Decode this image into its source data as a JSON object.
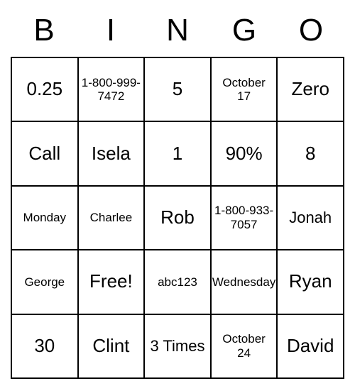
{
  "header": [
    "B",
    "I",
    "N",
    "G",
    "O"
  ],
  "grid": [
    [
      {
        "text": "0.25",
        "size": "normal"
      },
      {
        "text": "1-800-999-7472",
        "size": "small"
      },
      {
        "text": "5",
        "size": "normal"
      },
      {
        "text": "October 17",
        "size": "small"
      },
      {
        "text": "Zero",
        "size": "normal"
      }
    ],
    [
      {
        "text": "Call",
        "size": "normal"
      },
      {
        "text": "Isela",
        "size": "normal"
      },
      {
        "text": "1",
        "size": "normal"
      },
      {
        "text": "90%",
        "size": "normal"
      },
      {
        "text": "8",
        "size": "normal"
      }
    ],
    [
      {
        "text": "Monday",
        "size": "small"
      },
      {
        "text": "Charlee",
        "size": "small"
      },
      {
        "text": "Rob",
        "size": "normal"
      },
      {
        "text": "1-800-933-7057",
        "size": "small"
      },
      {
        "text": "Jonah",
        "size": "medium"
      }
    ],
    [
      {
        "text": "George",
        "size": "small"
      },
      {
        "text": "Free!",
        "size": "normal"
      },
      {
        "text": "abc123",
        "size": "small"
      },
      {
        "text": "Wednesday",
        "size": "small"
      },
      {
        "text": "Ryan",
        "size": "normal"
      }
    ],
    [
      {
        "text": "30",
        "size": "normal"
      },
      {
        "text": "Clint",
        "size": "normal"
      },
      {
        "text": "3 Times",
        "size": "medium"
      },
      {
        "text": "October 24",
        "size": "small"
      },
      {
        "text": "David",
        "size": "normal"
      }
    ]
  ]
}
